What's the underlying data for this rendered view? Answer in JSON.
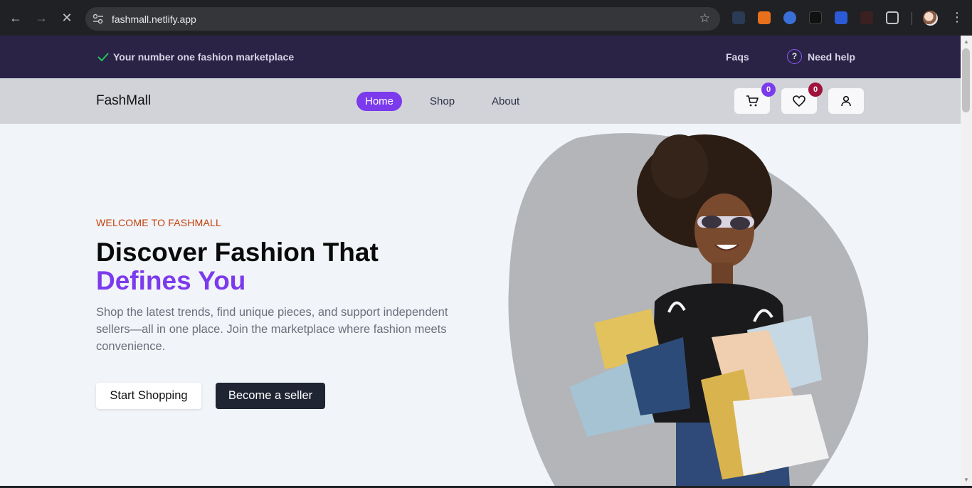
{
  "browser": {
    "url": "fashmall.netlify.app"
  },
  "topbar": {
    "tagline": "Your number one fashion marketplace",
    "faqs": "Faqs",
    "help_icon_glyph": "?",
    "help": "Need help"
  },
  "navbar": {
    "logo": "FashMall",
    "links": [
      {
        "label": "Home",
        "active": true
      },
      {
        "label": "Shop",
        "active": false
      },
      {
        "label": "About",
        "active": false
      }
    ],
    "cart_count": "0",
    "wishlist_count": "0"
  },
  "hero": {
    "eyebrow": "WELCOME TO FASHMALL",
    "headline_line1": "Discover Fashion That",
    "headline_line2": "Defines You",
    "description": "Shop the latest trends, find unique pieces, and support independent sellers—all in one place. Join the marketplace where fashion meets convenience.",
    "primary_button": "Start Shopping",
    "secondary_button": "Become a seller"
  },
  "colors": {
    "brand_purple": "#7c3aed",
    "topbar_bg": "#2a2346",
    "eyebrow_orange": "#c2410c",
    "cart_badge": "#7c3aed",
    "wishlist_badge": "#9f1239"
  }
}
